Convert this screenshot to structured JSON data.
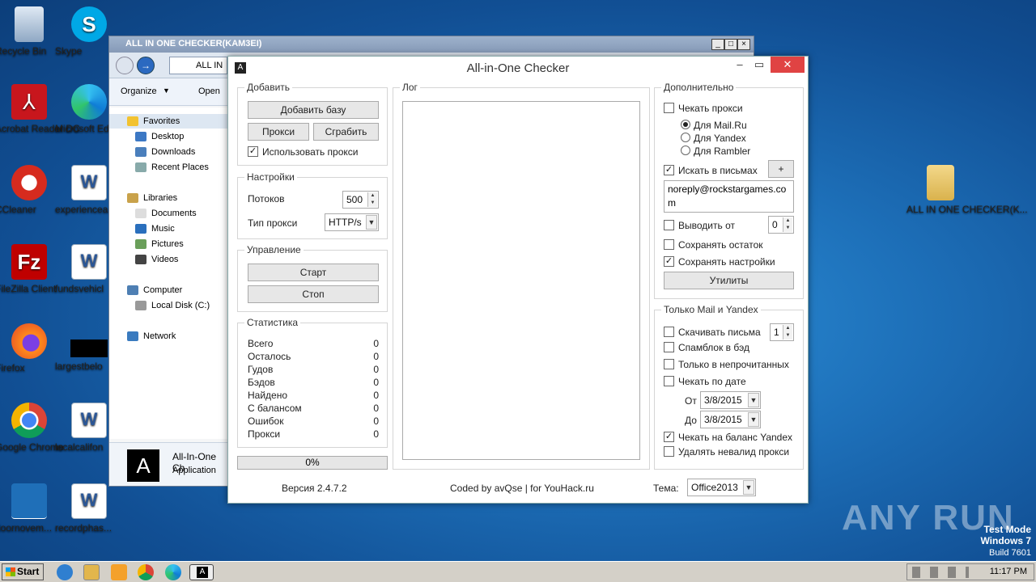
{
  "desktop": {
    "icons_left": [
      {
        "label": "Recycle Bin"
      },
      {
        "label": "Acrobat Reader DC"
      },
      {
        "label": "CCleaner"
      },
      {
        "label": "FileZilla Client"
      },
      {
        "label": "Firefox"
      },
      {
        "label": "Google Chrome"
      },
      {
        "label": "doornovem..."
      }
    ],
    "icons_second": [
      {
        "label": "Skype"
      },
      {
        "label": "Microsoft Ed"
      },
      {
        "label": "experiencea"
      },
      {
        "label": "fundsvehicl"
      },
      {
        "label": "largestbelo"
      },
      {
        "label": "localcalifon"
      },
      {
        "label": "recordphas..."
      }
    ],
    "right_icon_label": "ALL IN ONE CHECKER(K...",
    "watermark": "ANY RUN",
    "testmode": {
      "line1": "Test Mode",
      "line2": "Windows 7",
      "line3": "Build 7601"
    }
  },
  "explorer": {
    "title": "ALL IN ONE CHECKER(KAM3EI)",
    "address": "ALL IN",
    "toolbar": {
      "organize": "Organize",
      "open": "Open"
    },
    "nav": {
      "favorites": "Favorites",
      "desktop": "Desktop",
      "downloads": "Downloads",
      "recent": "Recent Places",
      "libraries": "Libraries",
      "documents": "Documents",
      "music": "Music",
      "pictures": "Pictures",
      "videos": "Videos",
      "computer": "Computer",
      "localdisk": "Local Disk (C:)",
      "network": "Network"
    },
    "details": {
      "name": "All-In-One Ch",
      "type": "Application"
    }
  },
  "app": {
    "title": "All-in-One Checker",
    "icon_letter": "A",
    "add": {
      "group": "Добавить",
      "add_base": "Добавить базу",
      "proxy": "Прокси",
      "grab": "Сграбить",
      "use_proxy": "Использовать прокси"
    },
    "settings": {
      "group": "Настройки",
      "threads_label": "Потоков",
      "threads_value": "500",
      "proxy_type_label": "Тип прокси",
      "proxy_type_value": "HTTP/s"
    },
    "control": {
      "group": "Управление",
      "start": "Старт",
      "stop": "Стоп"
    },
    "stats": {
      "group": "Статистика",
      "rows": [
        {
          "label": "Всего",
          "value": "0"
        },
        {
          "label": "Осталось",
          "value": "0"
        },
        {
          "label": "Гудов",
          "value": "0"
        },
        {
          "label": "Бэдов",
          "value": "0"
        },
        {
          "label": "Найдено",
          "value": "0"
        },
        {
          "label": "С балансом",
          "value": "0"
        },
        {
          "label": "Ошибок",
          "value": "0"
        },
        {
          "label": "Прокси",
          "value": "0"
        }
      ]
    },
    "progress": {
      "text": "0%",
      "fraction": 0
    },
    "log": {
      "group": "Лог"
    },
    "extra": {
      "group": "Дополнительно",
      "check_proxy": "Чекать прокси",
      "for_mailru": "Для Mail.Ru",
      "for_yandex": "Для Yandex",
      "for_rambler": "Для Rambler",
      "search_in_letters": "Искать в письмах",
      "plus": "+",
      "search_text_line1": "noreply@rockstargames.co",
      "search_text_line2": "m",
      "output_from": "Выводить от",
      "output_from_value": "0",
      "save_rest": "Сохранять остаток",
      "save_settings": "Сохранять настройки",
      "utilities": "Утилиты"
    },
    "mailyandex": {
      "group": "Только Mail и Yandex",
      "download_letters": "Скачивать письма",
      "download_value": "1",
      "spamblock": "Спамблок в бэд",
      "only_unread": "Только в непрочитанных",
      "check_by_date": "Чекать по дате",
      "from_label": "От",
      "from_date": "3/8/2015",
      "to_label": "До",
      "to_date": "3/8/2015",
      "check_balance_yandex": "Чекать на баланс Yandex",
      "remove_invalid_proxy": "Удалять невалид прокси"
    },
    "footer": {
      "version": "Версия 2.4.7.2",
      "coded": "Coded by avQse | for YouHack.ru",
      "theme_label": "Тема:",
      "theme_value": "Office2013"
    }
  },
  "taskbar": {
    "start": "Start",
    "time": "11:17 PM"
  }
}
